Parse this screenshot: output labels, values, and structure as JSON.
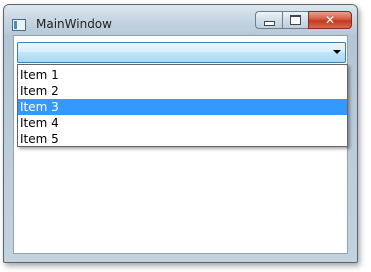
{
  "window": {
    "title": "MainWindow"
  },
  "caption": {
    "close_label": "✕"
  },
  "combobox": {
    "selected_value": "",
    "dropdown_open": true,
    "items": [
      "Item 1",
      "Item 2",
      "Item 3",
      "Item 4",
      "Item 5"
    ],
    "highlighted_index": 2
  },
  "colors": {
    "highlight": "#3399ff",
    "close_button": "#c2391f",
    "combo_accent": "#a7d9f5"
  }
}
